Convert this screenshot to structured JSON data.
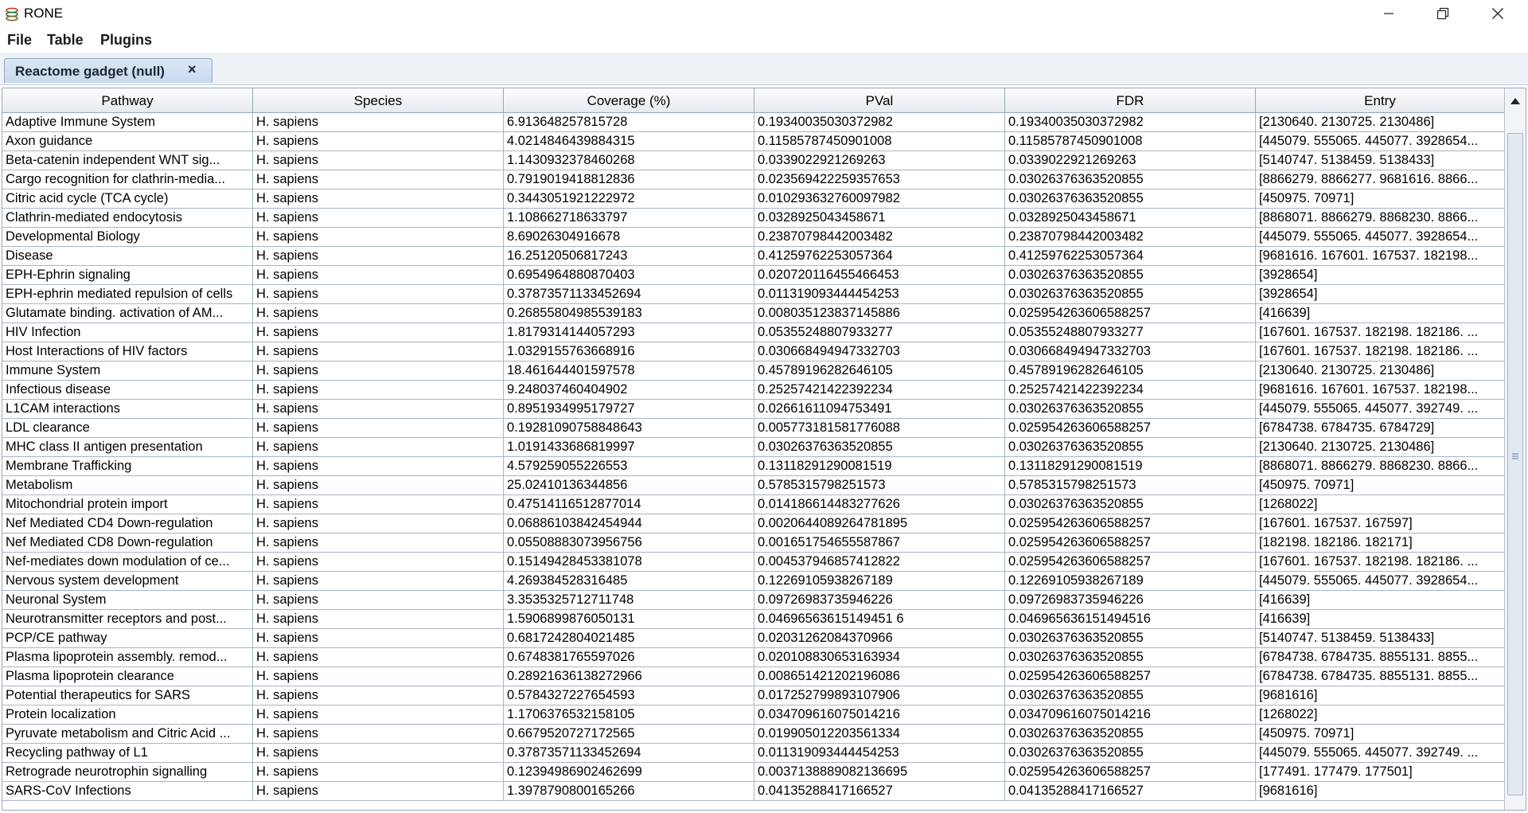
{
  "window": {
    "title": "RONE",
    "app_icon": "stacked-layers-icon",
    "controls": [
      "minimize-icon",
      "restore-icon",
      "close-icon"
    ]
  },
  "menu": [
    "File",
    "Table",
    "Plugins"
  ],
  "tabs": [
    {
      "label": "Reactome gadget (null)",
      "close_glyph": "×"
    }
  ],
  "table": {
    "columns": [
      "Pathway",
      "Species",
      "Coverage (%)",
      "PVal",
      "FDR",
      "Entry"
    ],
    "rows": [
      [
        "Adaptive Immune System",
        "H. sapiens",
        "6.913648257815728",
        "0.19340035030372982",
        "0.19340035030372982",
        "[2130640. 2130725. 2130486]"
      ],
      [
        "Axon guidance",
        "H. sapiens",
        "4.0214846439884315",
        "0.11585787450901008",
        "0.11585787450901008",
        "[445079. 555065. 445077. 3928654..."
      ],
      [
        "Beta-catenin independent WNT sig...",
        "H. sapiens",
        "1.1430932378460268",
        "0.0339022921269263",
        "0.0339022921269263",
        "[5140747. 5138459. 5138433]"
      ],
      [
        "Cargo recognition for clathrin-media...",
        "H. sapiens",
        "0.7919019418812836",
        "0.023569422259357653",
        "0.03026376363520855",
        "[8866279. 8866277. 9681616. 8866..."
      ],
      [
        "Citric acid cycle (TCA cycle)",
        "H. sapiens",
        "0.3443051921222972",
        "0.010293632760097982",
        "0.03026376363520855",
        "[450975. 70971]"
      ],
      [
        "Clathrin-mediated endocytosis",
        "H. sapiens",
        "1.108662718633797",
        "0.0328925043458671",
        "0.0328925043458671",
        "[8868071. 8866279. 8868230. 8866..."
      ],
      [
        "Developmental Biology",
        "H. sapiens",
        "8.69026304916678",
        "0.23870798442003482",
        "0.23870798442003482",
        "[445079. 555065. 445077. 3928654..."
      ],
      [
        "Disease",
        "H. sapiens",
        "16.25120506817243",
        "0.41259762253057364",
        "0.41259762253057364",
        "[9681616. 167601. 167537. 182198..."
      ],
      [
        "EPH-Ephrin signaling",
        "H. sapiens",
        "0.6954964880870403",
        "0.020720116455466453",
        "0.03026376363520855",
        "[3928654]"
      ],
      [
        "EPH-ephrin mediated repulsion of cells",
        "H. sapiens",
        "0.37873571133452694",
        "0.011319093444454253",
        "0.03026376363520855",
        "[3928654]"
      ],
      [
        "Glutamate binding. activation of AM...",
        "H. sapiens",
        "0.26855804985539183",
        "0.008035123837145886",
        "0.025954263606588257",
        "[416639]"
      ],
      [
        "HIV Infection",
        "H. sapiens",
        "1.8179314144057293",
        "0.05355248807933277",
        "0.05355248807933277",
        "[167601. 167537. 182198. 182186. ..."
      ],
      [
        "Host Interactions of HIV factors",
        "H. sapiens",
        "1.0329155763668916",
        "0.030668494947332703",
        "0.030668494947332703",
        "[167601. 167537. 182198. 182186. ..."
      ],
      [
        "Immune System",
        "H. sapiens",
        "18.461644401597578",
        "0.45789196282646105",
        "0.45789196282646105",
        "[2130640. 2130725. 2130486]"
      ],
      [
        "Infectious disease",
        "H. sapiens",
        "9.248037460404902",
        "0.25257421422392234",
        "0.25257421422392234",
        "[9681616. 167601. 167537. 182198..."
      ],
      [
        "L1CAM interactions",
        "H. sapiens",
        "0.8951934995179727",
        "0.02661611094753491",
        "0.03026376363520855",
        "[445079. 555065. 445077. 392749. ..."
      ],
      [
        "LDL clearance",
        "H. sapiens",
        "0.19281090758848643",
        "0.005773181581776088",
        "0.025954263606588257",
        "[6784738. 6784735. 6784729]"
      ],
      [
        "MHC class II antigen presentation",
        "H. sapiens",
        "1.0191433686819997",
        "0.03026376363520855",
        "0.03026376363520855",
        "[2130640. 2130725. 2130486]"
      ],
      [
        "Membrane Trafficking",
        "H. sapiens",
        "4.579259055226553",
        "0.13118291290081519",
        "0.13118291290081519",
        "[8868071. 8866279. 8868230. 8866..."
      ],
      [
        "Metabolism",
        "H. sapiens",
        "25.02410136344856",
        "0.5785315798251573",
        "0.5785315798251573",
        "[450975. 70971]"
      ],
      [
        "Mitochondrial protein import",
        "H. sapiens",
        "0.47514116512877014",
        "0.014186614483277626",
        "0.03026376363520855",
        "[1268022]"
      ],
      [
        "Nef Mediated CD4 Down-regulation",
        "H. sapiens",
        "0.06886103842454944",
        "0.0020644089264781895",
        "0.025954263606588257",
        "[167601. 167537. 167597]"
      ],
      [
        "Nef Mediated CD8 Down-regulation",
        "H. sapiens",
        "0.05508883073956756",
        "0.001651754655587867",
        "0.025954263606588257",
        "[182198. 182186. 182171]"
      ],
      [
        "Nef-mediates down modulation of ce...",
        "H. sapiens",
        "0.15149428453381078",
        "0.004537946857412822",
        "0.025954263606588257",
        "[167601. 167537. 182198. 182186. ..."
      ],
      [
        "Nervous system development",
        "H. sapiens",
        "4.269384528316485",
        "0.12269105938267189",
        "0.12269105938267189",
        "[445079. 555065. 445077. 3928654..."
      ],
      [
        "Neuronal System",
        "H. sapiens",
        "3.3535325712711748",
        "0.09726983735946226",
        "0.09726983735946226",
        "[416639]"
      ],
      [
        "Neurotransmitter receptors and post...",
        "H. sapiens",
        "1.5906899876050131",
        "0.04696563615149451 6",
        "0.046965636151494516",
        "[416639]"
      ],
      [
        "PCP/CE pathway",
        "H. sapiens",
        "0.6817242804021485",
        "0.02031262084370966",
        "0.03026376363520855",
        "[5140747. 5138459. 5138433]"
      ],
      [
        "Plasma lipoprotein assembly. remod...",
        "H. sapiens",
        "0.6748381765597026",
        "0.020108830653163934",
        "0.03026376363520855",
        "[6784738. 6784735. 8855131. 8855..."
      ],
      [
        "Plasma lipoprotein clearance",
        "H. sapiens",
        "0.28921636138272966",
        "0.008651421202196086",
        "0.025954263606588257",
        "[6784738. 6784735. 8855131. 8855..."
      ],
      [
        "Potential therapeutics for SARS",
        "H. sapiens",
        "0.5784327227654593",
        "0.017252799893107906",
        "0.03026376363520855",
        "[9681616]"
      ],
      [
        "Protein localization",
        "H. sapiens",
        "1.1706376532158105",
        "0.034709616075014216",
        "0.034709616075014216",
        "[1268022]"
      ],
      [
        "Pyruvate metabolism and Citric Acid ...",
        "H. sapiens",
        "0.6679520727172565",
        "0.019905012203561334",
        "0.03026376363520855",
        "[450975. 70971]"
      ],
      [
        "Recycling pathway of L1",
        "H. sapiens",
        "0.37873571133452694",
        "0.011319093444454253",
        "0.03026376363520855",
        "[445079. 555065. 445077. 392749. ..."
      ],
      [
        "Retrograde neurotrophin signalling",
        "H. sapiens",
        "0.12394986902462699",
        "0.0037138889082136695",
        "0.025954263606588257",
        "[177491. 177479. 177501]"
      ],
      [
        "SARS-CoV Infections",
        "H. sapiens",
        "1.3978790800165266",
        "0.04135288417166527",
        "0.04135288417166527",
        "[9681616]"
      ]
    ]
  }
}
